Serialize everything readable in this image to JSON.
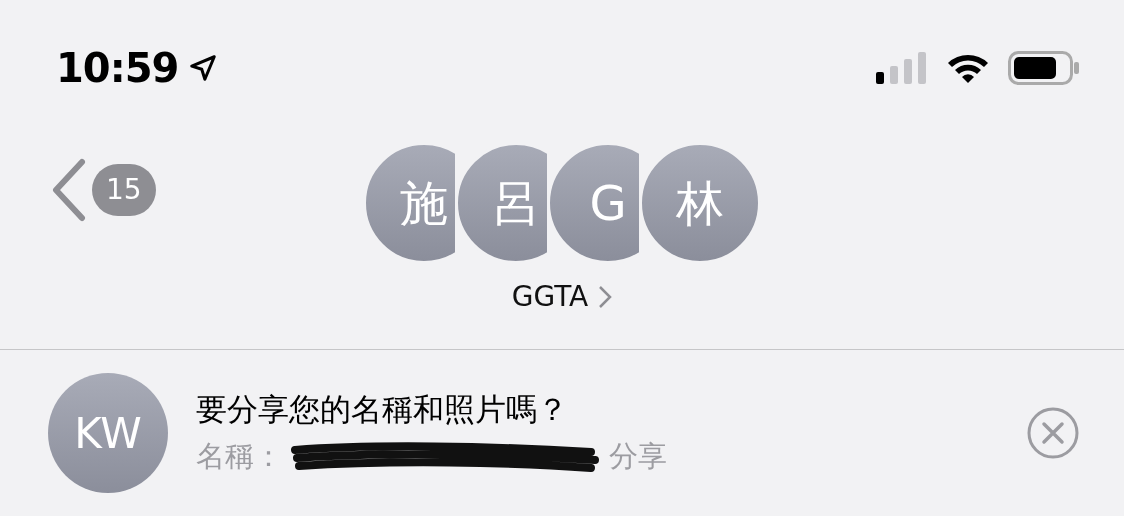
{
  "status_bar": {
    "time": "10:59"
  },
  "nav": {
    "back_count": "15",
    "avatars": [
      {
        "initial": "施"
      },
      {
        "initial": "呂"
      },
      {
        "initial": "G"
      },
      {
        "initial": "林"
      }
    ],
    "group_name": "GGTA"
  },
  "banner": {
    "avatar": "KW",
    "title": "要分享您的名稱和照片嗎？",
    "name_label": "名稱：",
    "action": "分享"
  }
}
